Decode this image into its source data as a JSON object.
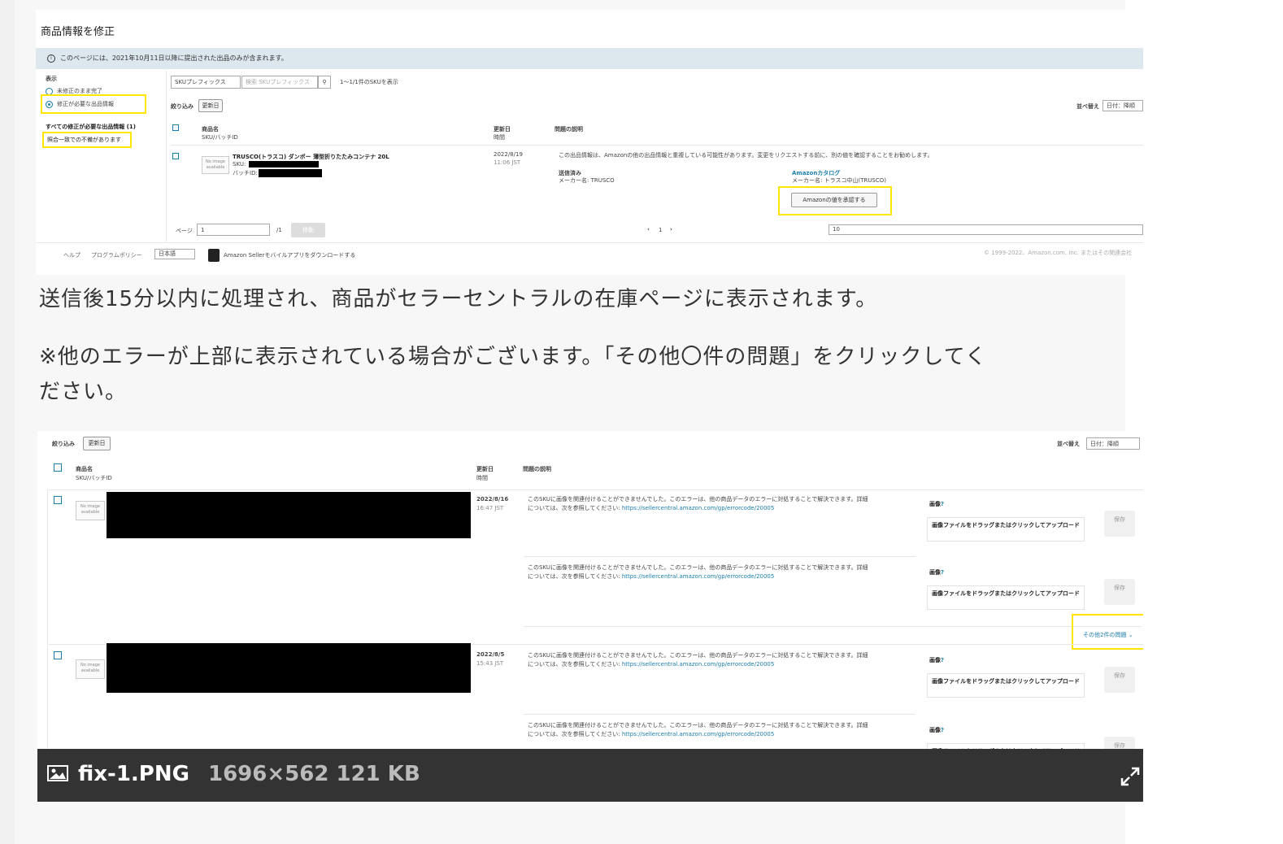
{
  "screenshot1": {
    "title": "商品情報を修正",
    "info": "このページには、2021年10月11日以降に提出された出品のみが含まれます。",
    "sidebar": {
      "display_label": "表示",
      "option_unmodified": "未修正のまま完了",
      "option_needs_fix": "修正が必要な出品情報",
      "all_needed_label": "すべての修正が必要な出品情報 (1)",
      "filter_item": "照合一致での不備があります"
    },
    "search": {
      "type_select": "SKUプレフィックス",
      "placeholder": "検索 SKUプレフィックス",
      "result_count": "1～1/1件のSKUを表示"
    },
    "filter_label": "絞り込み",
    "filter_button": "更新日",
    "sort_label": "並べ替え",
    "sort_value": "日付：降順",
    "columns": {
      "product": "商品名",
      "product_sub": "SKU/バッチID",
      "updated": "更新日",
      "updated_sub": "時間",
      "issue": "問題の説明"
    },
    "row": {
      "title": "TRUSCO(トラスコ) ダンボー 薄型折りたたみコンテナ 20L",
      "sku_label": "SKU:",
      "batch_label": "バッチID:",
      "date": "2022/8/19",
      "time": "11:06 JST",
      "issue_text": "この出品情報は、Amazonの他の出品情報と重複している可能性があります。変更をリクエストする前に、別の値を確認することをお勧めします。",
      "sent_label": "送信済み",
      "sent_maker": "メーカー名: TRUSCO",
      "catalog_label": "Amazonカタログ",
      "catalog_maker": "メーカー名: トラスコ中山(TRUSCO)",
      "confirm_button": "Amazonの値を承認する"
    },
    "pager": {
      "page_label": "ページ",
      "page_value": "1",
      "page_total": "/1",
      "go": "移動",
      "prev": "‹",
      "current": "1",
      "next": "›",
      "per_page": "10"
    },
    "footer": {
      "help": "ヘルプ",
      "policy": "プログラムポリシー",
      "language": "日本語",
      "app": "Amazon Sellerモバイルアプリをダウンロードする",
      "copyright": "© 1999-2022、Amazon.com, Inc. またはその関連会社"
    }
  },
  "paragraph1": "送信後15分以内に処理され、商品がセラーセントラルの在庫ページに表示されます。",
  "paragraph2_line1": "※他のエラーが上部に表示されている場合がございます。「その他〇件の問題」をクリックしてく",
  "paragraph2_line2": "ださい。",
  "screenshot2": {
    "filter_label": "絞り込み",
    "filter_button": "更新日",
    "sort_label": "並べ替え",
    "sort_value": "日付：降順",
    "columns": {
      "product": "商品名",
      "product_sub": "SKU/バッチID",
      "updated": "更新日",
      "updated_sub": "時間",
      "issue": "問題の説明"
    },
    "rows": [
      {
        "date": "2022/8/16",
        "time": "16:47 JST"
      },
      {
        "date": "2022/8/5",
        "time": "15:43 JST"
      }
    ],
    "error_line1": "このSKUに画像を関連付けることができませんでした。このエラーは、他の商品データのエラーに対処することで解決できます。詳細",
    "error_line2_prefix": "については、次を参照してください: ",
    "error_link": "https://sellercentral.amazon.com/gp/errorcode/20005",
    "image_label": "画像",
    "upload_label": "画像ファイルをドラッグまたはクリックしてアップロード",
    "save_label": "保存",
    "more_issues": "その他2件の問題",
    "no_image": "No image available"
  },
  "caption": {
    "filename": "fix-1.PNG",
    "meta": "1696×562 121 KB"
  },
  "colors": {
    "highlight": "#ffe600",
    "link": "#1b7eae",
    "caption_bg": "#333333"
  }
}
